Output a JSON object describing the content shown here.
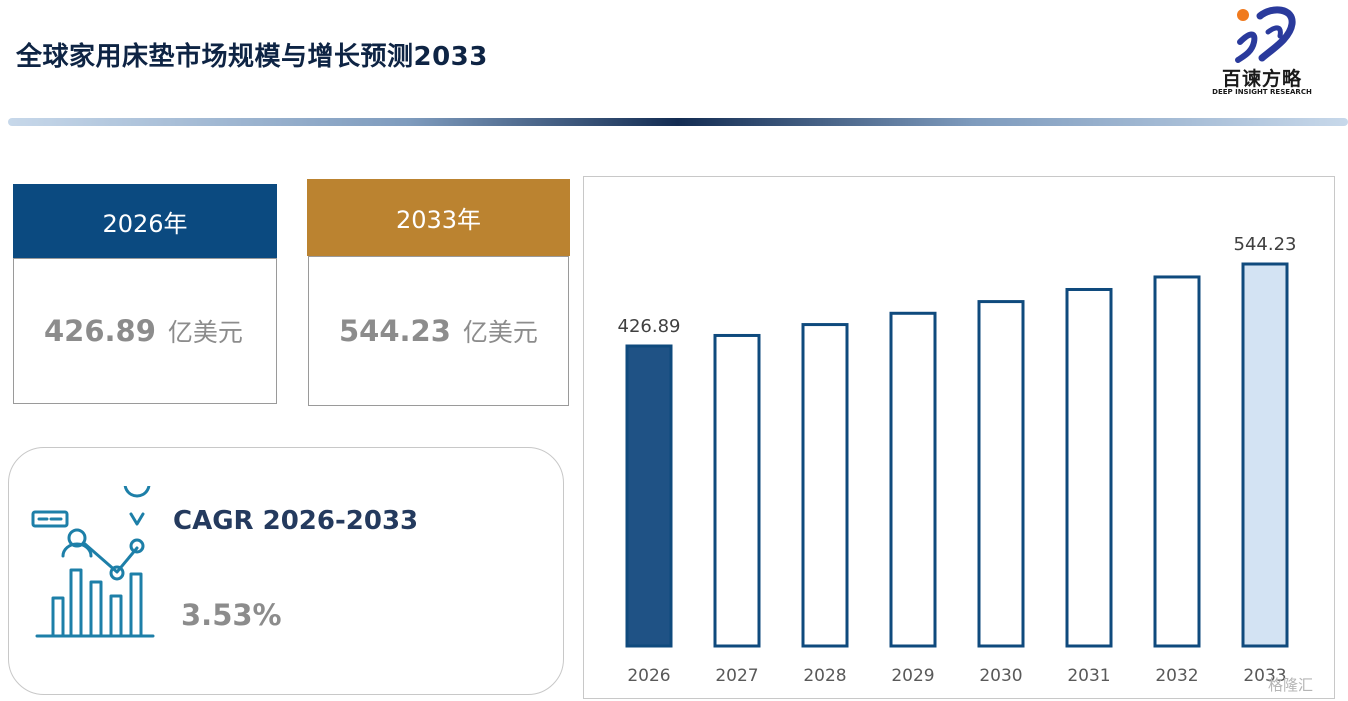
{
  "header": {
    "title": "全球家用床垫市场规模与增长预测2033",
    "logo_brand": "百谏方略",
    "logo_sub": "DEEP INSIGHT RESEARCH"
  },
  "cards": [
    {
      "year_label": "2026年",
      "value": "426.89",
      "unit": "亿美元",
      "color": "#0b4a80"
    },
    {
      "year_label": "2033年",
      "value": "544.23",
      "unit": "亿美元",
      "color": "#bb8330"
    }
  ],
  "cagr": {
    "label": "CAGR 2026-2033",
    "value": "3.53%",
    "icon": "chart-growth-icon"
  },
  "chart_data": {
    "type": "bar",
    "categories": [
      "2026",
      "2027",
      "2028",
      "2029",
      "2030",
      "2031",
      "2032",
      "2033"
    ],
    "values": [
      426.89,
      441.96,
      457.56,
      473.71,
      490.44,
      507.75,
      525.67,
      544.23
    ],
    "data_labels": [
      "426.89",
      "",
      "",
      "",
      "",
      "",
      "",
      "544.23"
    ],
    "ylim": [
      0,
      560
    ],
    "grid": false,
    "legend": "none",
    "colors": {
      "first_fill": "#1f5285",
      "last_fill": "#d3e3f3",
      "middle_fill": "#ffffff",
      "stroke": "#0f4a7d"
    }
  },
  "watermark": "格隆汇"
}
